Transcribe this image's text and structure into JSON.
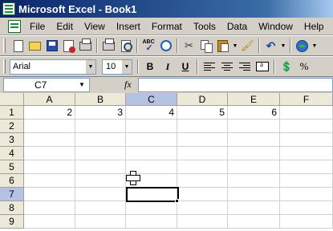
{
  "window": {
    "title": "Microsoft Excel - Book1",
    "app_icon": "excel-icon"
  },
  "menu": {
    "items": [
      "File",
      "Edit",
      "View",
      "Insert",
      "Format",
      "Tools",
      "Data",
      "Window",
      "Help"
    ]
  },
  "standard_toolbar": {
    "buttons": [
      "new-icon",
      "open-icon",
      "save-icon",
      "permission-icon",
      "print-icon",
      "print-preview-icon",
      "spelling-icon",
      "research-icon",
      "cut-icon",
      "copy-icon",
      "paste-icon",
      "format-painter-icon",
      "undo-icon",
      "help-icon"
    ],
    "spelling_label": "ABC"
  },
  "formatting_toolbar": {
    "font_name": "Arial",
    "font_size": "10",
    "bold_label": "B",
    "italic_label": "I",
    "underline_label": "U",
    "percent_label": "%"
  },
  "formula_bar": {
    "name_box": "C7",
    "fx_label": "fx",
    "formula": ""
  },
  "sheet": {
    "columns": [
      "A",
      "B",
      "C",
      "D",
      "E",
      "F"
    ],
    "rows": [
      "1",
      "2",
      "3",
      "4",
      "5",
      "6",
      "7",
      "8",
      "9"
    ],
    "selected_column": "C",
    "selected_row": "7",
    "row1_values": [
      "2",
      "3",
      "4",
      "5",
      "6",
      ""
    ]
  }
}
